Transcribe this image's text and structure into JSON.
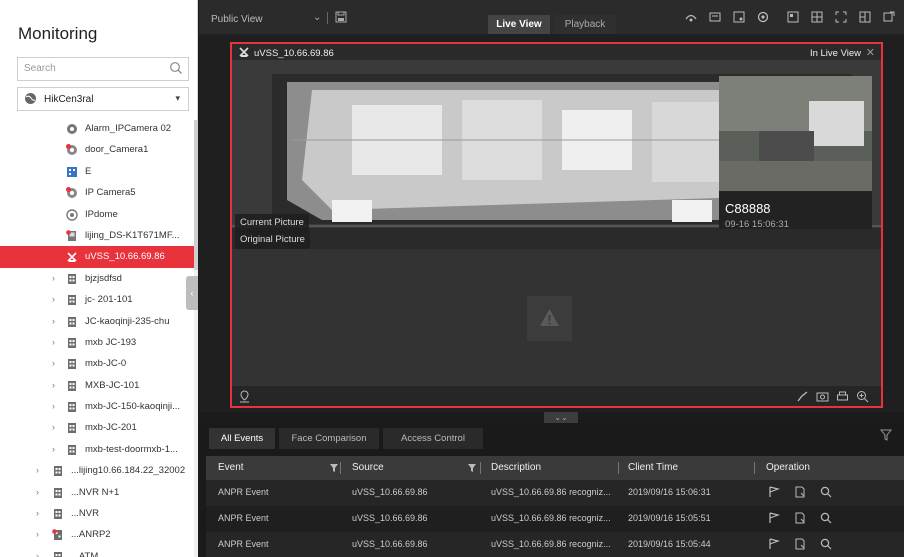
{
  "sidebar": {
    "title": "Monitoring",
    "search_placeholder": "Search",
    "site_name": "HikCen3ral",
    "tree": [
      {
        "label": "Alarm_IPCamera 02",
        "icon": "camera-icon",
        "level": 2
      },
      {
        "label": "door_Camera1",
        "icon": "camera-alert-icon",
        "level": 2
      },
      {
        "label": "E",
        "icon": "grid-device-icon",
        "level": 2
      },
      {
        "label": "IP Camera5",
        "icon": "camera-alert-icon",
        "level": 2
      },
      {
        "label": "IPdome",
        "icon": "dome-camera-icon",
        "level": 2
      },
      {
        "label": "lijing_DS-K1T671MF...",
        "icon": "access-terminal-icon",
        "level": 2
      },
      {
        "label": "uVSS_10.66.69.86",
        "icon": "uvss-icon",
        "level": 2,
        "selected": true
      },
      {
        "label": "bjzjsdfsd",
        "icon": "building-icon",
        "level": 1,
        "arrow": true
      },
      {
        "label": "jc- 201-101",
        "icon": "building-icon",
        "level": 1,
        "arrow": true
      },
      {
        "label": "JC-kaoqinji-235-chu",
        "icon": "building-icon",
        "level": 1,
        "arrow": true
      },
      {
        "label": "mxb JC-193",
        "icon": "building-icon",
        "level": 1,
        "arrow": true
      },
      {
        "label": "mxb-JC-0",
        "icon": "building-icon",
        "level": 1,
        "arrow": true
      },
      {
        "label": "MXB-JC-101",
        "icon": "building-icon",
        "level": 1,
        "arrow": true
      },
      {
        "label": "mxb-JC-150-kaoqinji...",
        "icon": "building-icon",
        "level": 1,
        "arrow": true
      },
      {
        "label": "mxb-JC-201",
        "icon": "building-icon",
        "level": 1,
        "arrow": true
      },
      {
        "label": "mxb-test-doormxb-1...",
        "icon": "building-icon",
        "level": 1,
        "arrow": true
      },
      {
        "label": "...lijing10.66.184.22_32002",
        "icon": "building-icon",
        "level": 0,
        "arrow": true
      },
      {
        "label": "...NVR N+1",
        "icon": "building-icon",
        "level": 0,
        "arrow": true
      },
      {
        "label": "...NVR",
        "icon": "building-icon",
        "level": 0,
        "arrow": true
      },
      {
        "label": "...ANRP2",
        "icon": "building-alert-icon",
        "level": 0,
        "arrow": true
      },
      {
        "label": "...ATM",
        "icon": "building-icon",
        "level": 0,
        "arrow": true
      }
    ]
  },
  "topbar": {
    "view_name": "Public View",
    "tabs": {
      "live": "Live View",
      "playback": "Playback"
    },
    "icons": [
      "fisheye-icon",
      "window-icon",
      "record-icon",
      "settings-icon",
      "layout-icon",
      "grid-icon",
      "fullscreen-icon",
      "split-icon",
      "extend-icon"
    ]
  },
  "video": {
    "camera_name": "uVSS_10.66.69.86",
    "status": "In Live View",
    "current_picture_label": "Current Picture",
    "original_picture_label": "Original Picture",
    "plate_number": "C88888",
    "capture_time": "09-16 15:06:31"
  },
  "events": {
    "tabs": [
      "All Events",
      "Face Comparison",
      "Access Control"
    ],
    "columns": {
      "event": "Event",
      "source": "Source",
      "description": "Description",
      "time": "Client Time",
      "operation": "Operation"
    },
    "rows": [
      {
        "event": "ANPR Event",
        "source": "uVSS_10.66.69.86",
        "description": "uVSS_10.66.69.86 recogniz...",
        "time": "2019/09/16 15:06:31"
      },
      {
        "event": "ANPR Event",
        "source": "uVSS_10.66.69.86",
        "description": "uVSS_10.66.69.86 recogniz...",
        "time": "2019/09/16 15:05:51"
      },
      {
        "event": "ANPR Event",
        "source": "uVSS_10.66.69.86",
        "description": "uVSS_10.66.69.86 recogniz...",
        "time": "2019/09/16 15:05:44"
      }
    ]
  },
  "colors": {
    "accent": "#e8323c",
    "dark_bg": "#1b1b1b"
  }
}
